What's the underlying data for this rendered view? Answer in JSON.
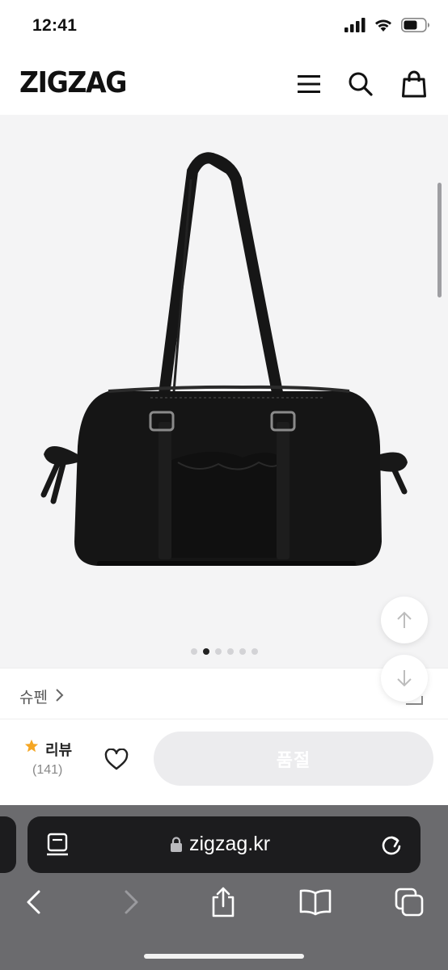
{
  "status": {
    "time": "12:41"
  },
  "header": {
    "logo": "ZIGZAG",
    "menu_icon": "menu-icon",
    "search_icon": "search-icon",
    "cart_icon": "shopping-bag-icon"
  },
  "product": {
    "image_alt": "black nylon shoulder bag",
    "carousel_total": 6,
    "carousel_active": 2
  },
  "shop": {
    "name": "슈펜"
  },
  "actions": {
    "review_label": "리뷰",
    "review_count": "(141)",
    "soldout_label": "품절",
    "star_color": "#f5a623"
  },
  "browser": {
    "url": "zigzag.kr"
  }
}
